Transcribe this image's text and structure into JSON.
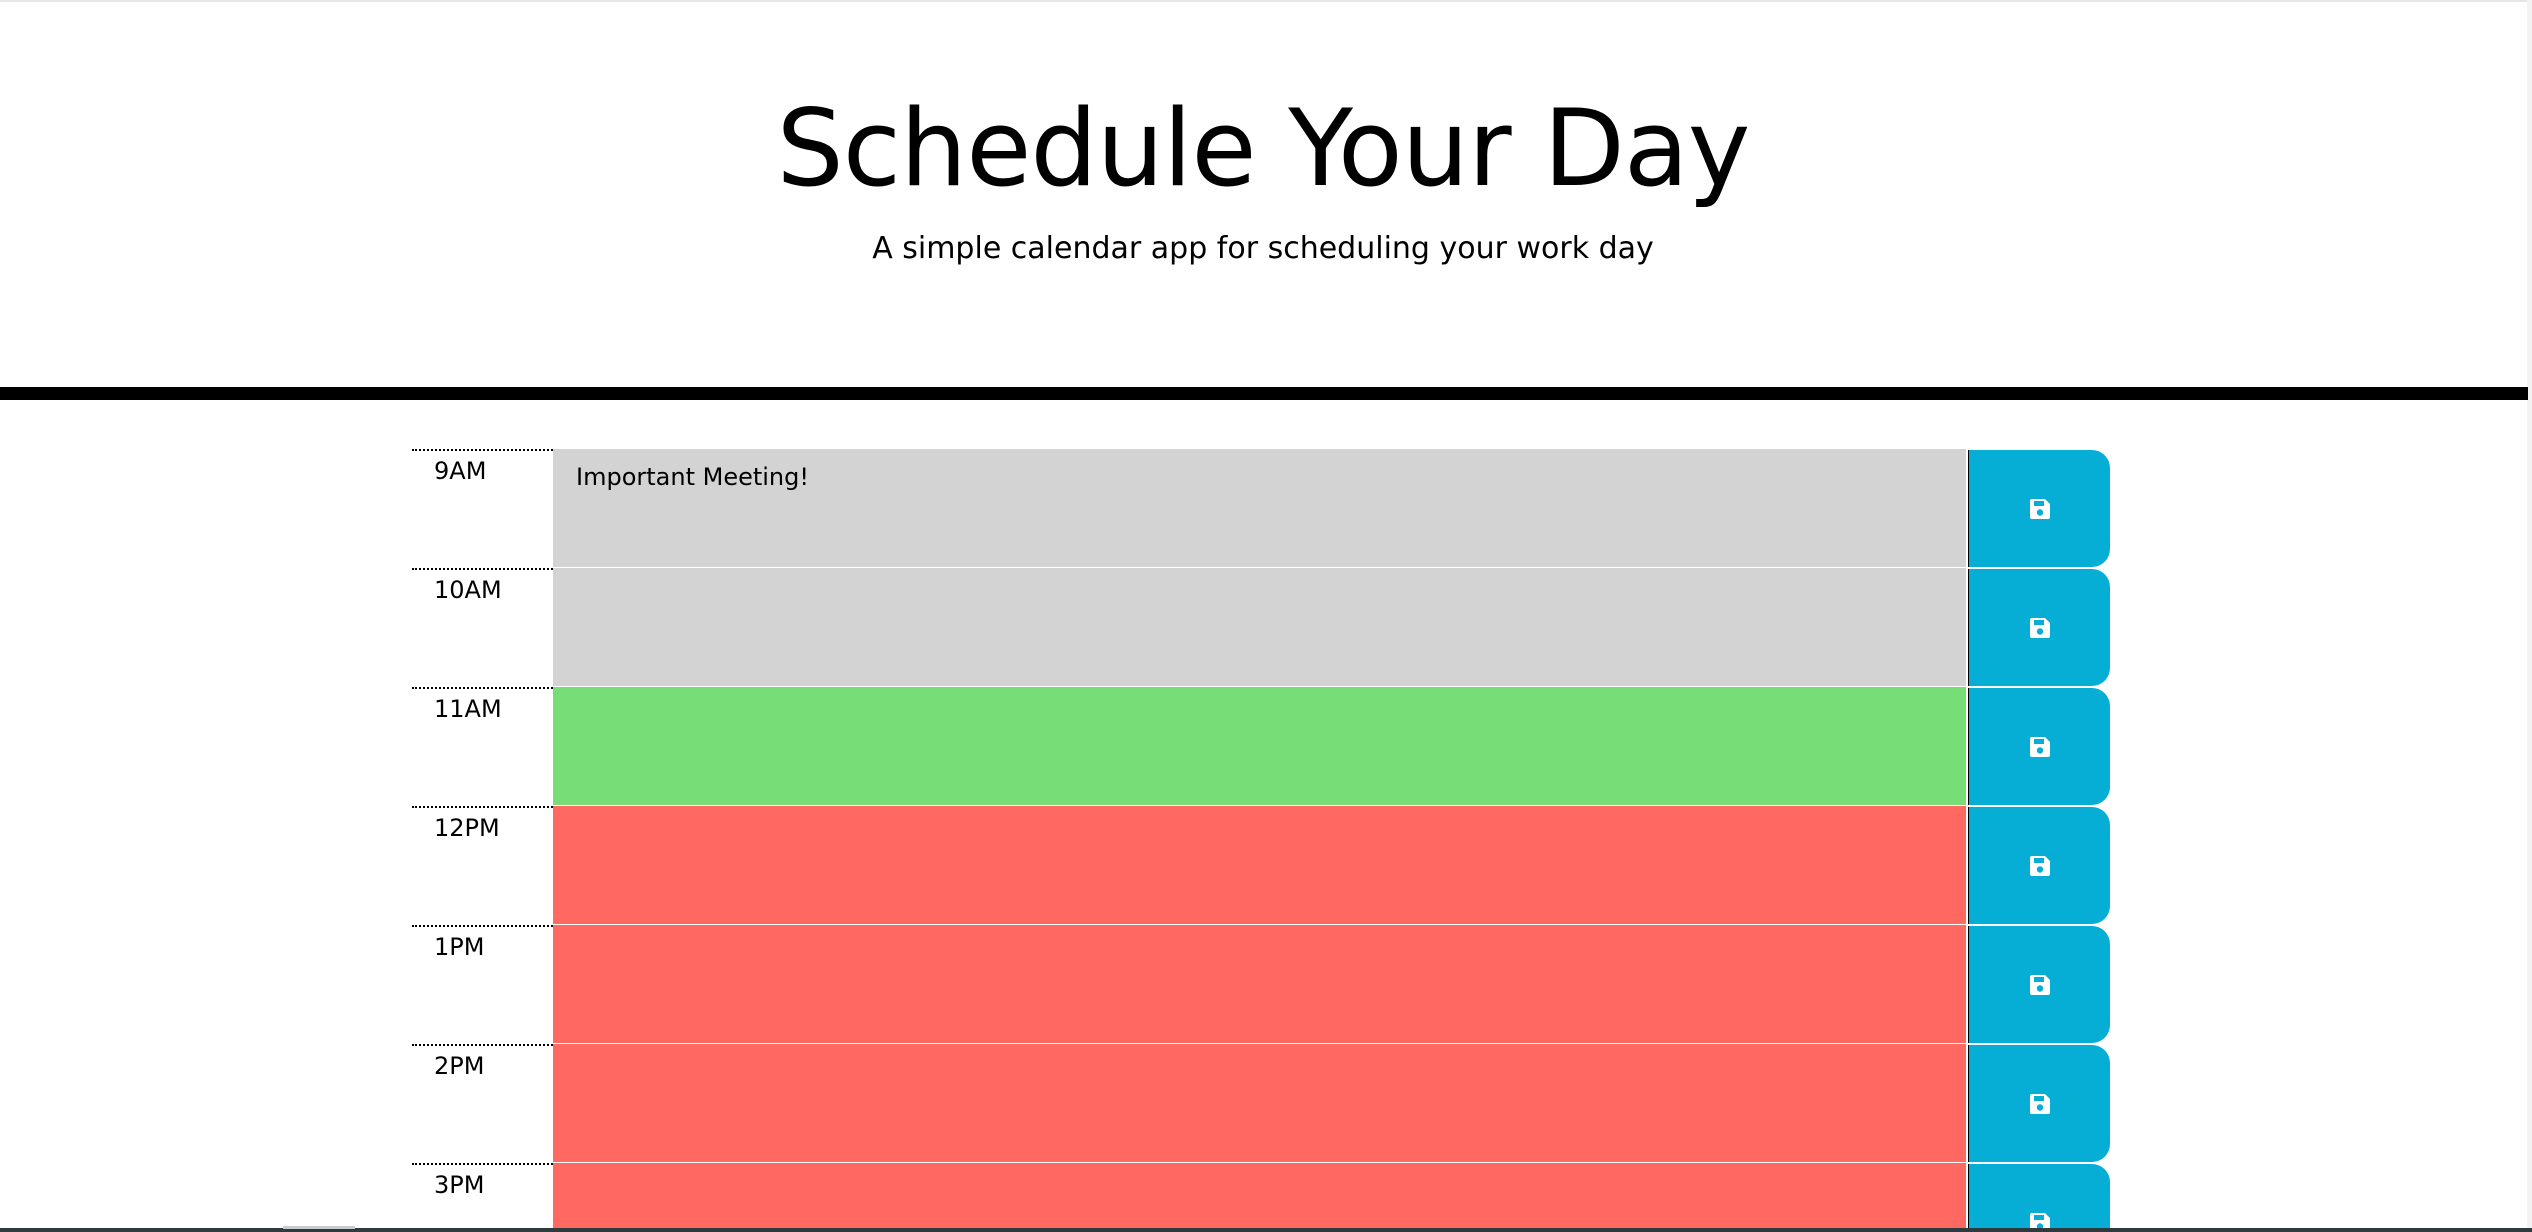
{
  "header": {
    "title": "Schedule Your Day",
    "subtitle": "A simple calendar app for scheduling your work day"
  },
  "timeblocks": [
    {
      "hour": "9AM",
      "text": "Important Meeting!",
      "status": "past"
    },
    {
      "hour": "10AM",
      "text": "",
      "status": "past"
    },
    {
      "hour": "11AM",
      "text": "",
      "status": "present"
    },
    {
      "hour": "12PM",
      "text": "",
      "status": "future"
    },
    {
      "hour": "1PM",
      "text": "",
      "status": "future"
    },
    {
      "hour": "2PM",
      "text": "",
      "status": "future"
    },
    {
      "hour": "3PM",
      "text": "",
      "status": "future"
    }
  ],
  "icons": {
    "save": "floppy-disk-icon"
  },
  "colors": {
    "past": "#d3d3d3",
    "present": "#77dd77",
    "future": "#ff6961",
    "save_button": "#06aed5",
    "header_rule": "#000000"
  }
}
